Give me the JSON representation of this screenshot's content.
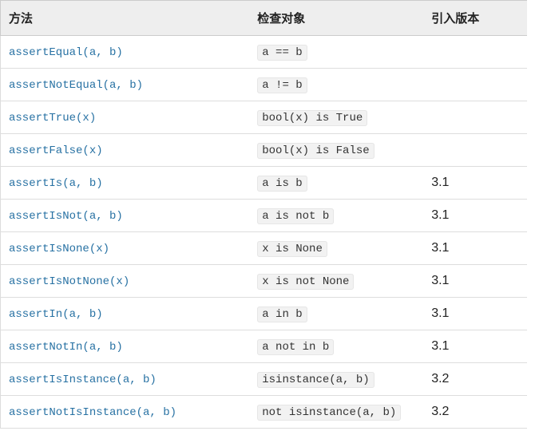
{
  "headers": {
    "method": "方法",
    "check": "检查对象",
    "version": "引入版本"
  },
  "rows": [
    {
      "method": "assertEqual(a, b)",
      "check": "a == b",
      "version": ""
    },
    {
      "method": "assertNotEqual(a, b)",
      "check": "a != b",
      "version": ""
    },
    {
      "method": "assertTrue(x)",
      "check": "bool(x) is True",
      "version": ""
    },
    {
      "method": "assertFalse(x)",
      "check": "bool(x) is False",
      "version": ""
    },
    {
      "method": "assertIs(a, b)",
      "check": "a is b",
      "version": "3.1"
    },
    {
      "method": "assertIsNot(a, b)",
      "check": "a is not b",
      "version": "3.1"
    },
    {
      "method": "assertIsNone(x)",
      "check": "x is None",
      "version": "3.1"
    },
    {
      "method": "assertIsNotNone(x)",
      "check": "x is not None",
      "version": "3.1"
    },
    {
      "method": "assertIn(a, b)",
      "check": "a in b",
      "version": "3.1"
    },
    {
      "method": "assertNotIn(a, b)",
      "check": "a not in b",
      "version": "3.1"
    },
    {
      "method": "assertIsInstance(a, b)",
      "check": "isinstance(a, b)",
      "version": "3.2"
    },
    {
      "method": "assertNotIsInstance(a, b)",
      "check": "not isinstance(a, b)",
      "version": "3.2"
    }
  ]
}
